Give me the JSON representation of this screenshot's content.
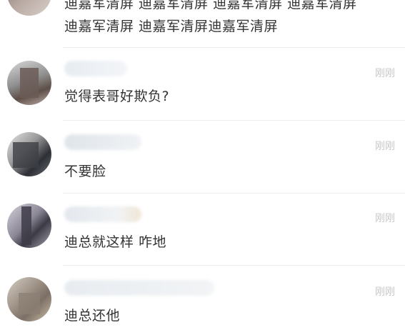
{
  "comments": [
    {
      "time": "",
      "lines": [
        "迪嘉军清屏 迪嘉军清屏 迪嘉军清屏 迪嘉军清屏",
        "迪嘉军清屏 迪嘉军清屏迪嘉军清屏"
      ]
    },
    {
      "time": "刚刚",
      "text": "觉得表哥好欺负?"
    },
    {
      "time": "刚刚",
      "text": "不要脸"
    },
    {
      "time": "刚刚",
      "text": "迪总就这样 咋地"
    },
    {
      "time": "刚刚",
      "text": "迪总还他"
    }
  ]
}
